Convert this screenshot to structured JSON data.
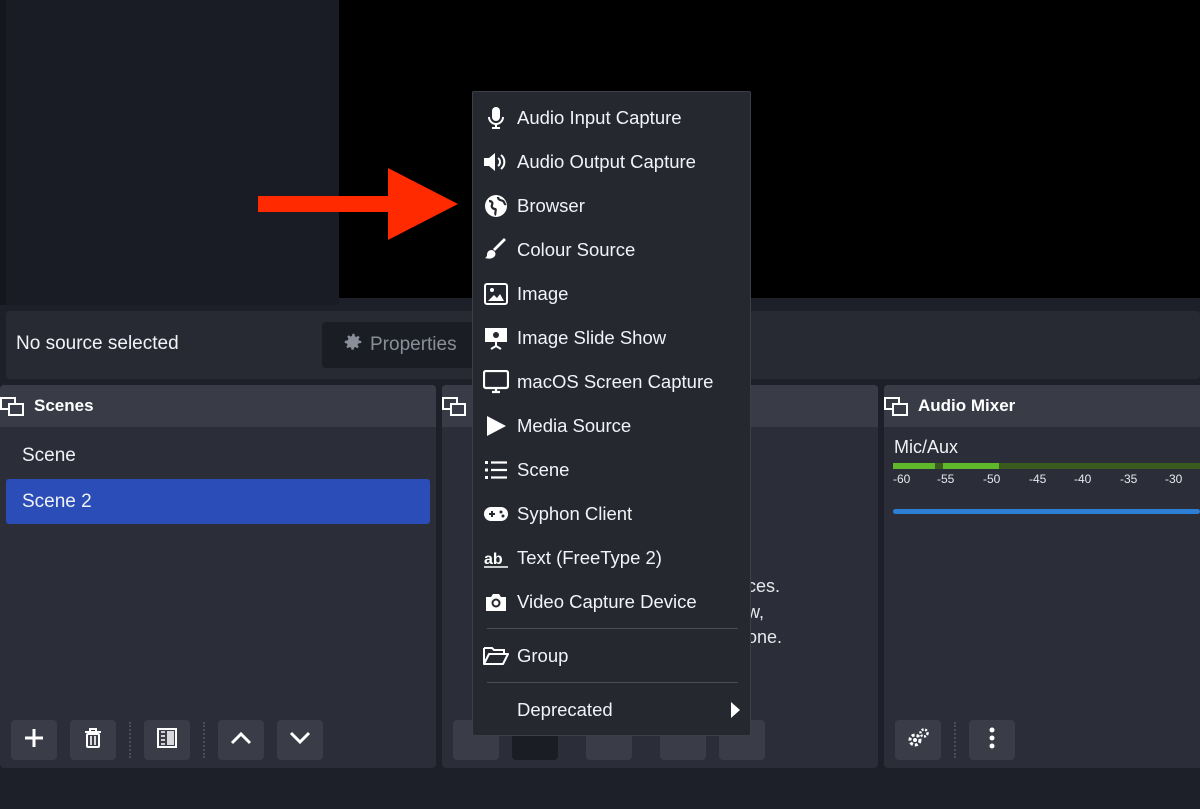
{
  "source_bar": {
    "status": "No source selected",
    "properties_label": "Properties"
  },
  "scenes": {
    "title": "Scenes",
    "items": [
      "Scene",
      "Scene 2"
    ],
    "active_index": 1
  },
  "sources_hint": [
    "ces.",
    "w,",
    "one."
  ],
  "audio_mixer": {
    "title": "Audio Mixer",
    "channel": "Mic/Aux",
    "ticks": [
      "-60",
      "-55",
      "-50",
      "-45",
      "-40",
      "-35",
      "-30"
    ]
  },
  "menu": {
    "items": [
      {
        "label": "Audio Input Capture",
        "icon": "microphone-icon"
      },
      {
        "label": "Audio Output Capture",
        "icon": "speaker-icon"
      },
      {
        "label": "Browser",
        "icon": "globe-icon"
      },
      {
        "label": "Colour Source",
        "icon": "paint-brush-icon"
      },
      {
        "label": "Image",
        "icon": "image-icon"
      },
      {
        "label": "Image Slide Show",
        "icon": "slideshow-icon"
      },
      {
        "label": "macOS Screen Capture",
        "icon": "monitor-icon"
      },
      {
        "label": "Media Source",
        "icon": "play-icon"
      },
      {
        "label": "Scene",
        "icon": "list-icon"
      },
      {
        "label": "Syphon Client",
        "icon": "gamepad-icon"
      },
      {
        "label": "Text (FreeType 2)",
        "icon": "text-icon"
      },
      {
        "label": "Video Capture Device",
        "icon": "camera-icon"
      }
    ],
    "group_label": "Group",
    "deprecated_label": "Deprecated"
  },
  "colors": {
    "accent": "#2a4db8",
    "arrow": "#ff2a00",
    "meter_green": "#5fb82a",
    "slider": "#2d7fd6"
  }
}
